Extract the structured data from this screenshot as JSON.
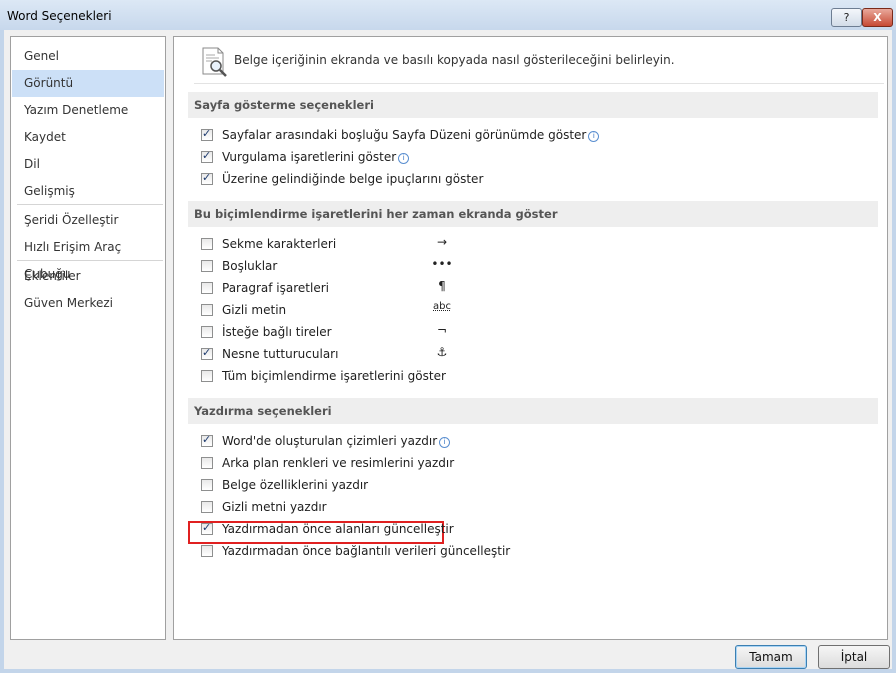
{
  "window": {
    "title": "Word Seçenekleri",
    "help_label": "?",
    "close_label": "X"
  },
  "sidebar": {
    "items": [
      {
        "label": "Genel"
      },
      {
        "label": "Görüntü",
        "selected": true
      },
      {
        "label": "Yazım Denetleme"
      },
      {
        "label": "Kaydet"
      },
      {
        "label": "Dil"
      },
      {
        "label": "Gelişmiş"
      },
      {
        "label": "Şeridi Özelleştir"
      },
      {
        "label": "Hızlı Erişim Araç Çubuğu"
      },
      {
        "label": "Eklentiler"
      },
      {
        "label": "Güven Merkezi"
      }
    ]
  },
  "main": {
    "intro_icon": "document-magnifier-icon",
    "intro": "Belge içeriğinin ekranda ve basılı kopyada nasıl gösterileceğini belirleyin.",
    "sections": [
      {
        "title": "Sayfa gösterme seçenekleri",
        "options": [
          {
            "label": "Sayfalar arasındaki boşluğu Sayfa Düzeni görünümde göster",
            "checked": true,
            "info": true
          },
          {
            "label": "Vurgulama işaretlerini göster",
            "checked": true,
            "info": true
          },
          {
            "label": "Üzerine gelindiğinde belge ipuçlarını göster",
            "checked": true
          }
        ]
      },
      {
        "title": "Bu biçimlendirme işaretlerini her zaman ekranda göster",
        "options": [
          {
            "label": "Sekme karakterleri",
            "checked": false,
            "symbol": "→"
          },
          {
            "label": "Boşluklar",
            "checked": false,
            "symbol": "•••"
          },
          {
            "label": "Paragraf işaretleri",
            "checked": false,
            "symbol": "¶"
          },
          {
            "label": "Gizli metin",
            "checked": false,
            "symbol": "abc"
          },
          {
            "label": "İsteğe bağlı tireler",
            "checked": false,
            "symbol": "¬"
          },
          {
            "label": "Nesne tutturucuları",
            "checked": true,
            "symbol": "⚓"
          },
          {
            "label": "Tüm biçimlendirme işaretlerini göster",
            "checked": false
          }
        ]
      },
      {
        "title": "Yazdırma seçenekleri",
        "options": [
          {
            "label": "Word'de oluşturulan çizimleri yazdır",
            "checked": true,
            "info": true
          },
          {
            "label": "Arka plan renkleri ve resimlerini yazdır",
            "checked": false
          },
          {
            "label": "Belge özelliklerini yazdır",
            "checked": false
          },
          {
            "label": "Gizli metni yazdır",
            "checked": false
          },
          {
            "label": "Yazdırmadan önce alanları güncelleştir",
            "checked": true,
            "highlighted": true
          },
          {
            "label": "Yazdırmadan önce bağlantılı verileri güncelleştir",
            "checked": false
          }
        ]
      }
    ]
  },
  "buttons": {
    "ok": "Tamam",
    "cancel": "İptal"
  },
  "colors": {
    "selected_nav": "#cce0f7",
    "highlight_border": "#e02020",
    "titlebar": "#c7d8ec"
  }
}
